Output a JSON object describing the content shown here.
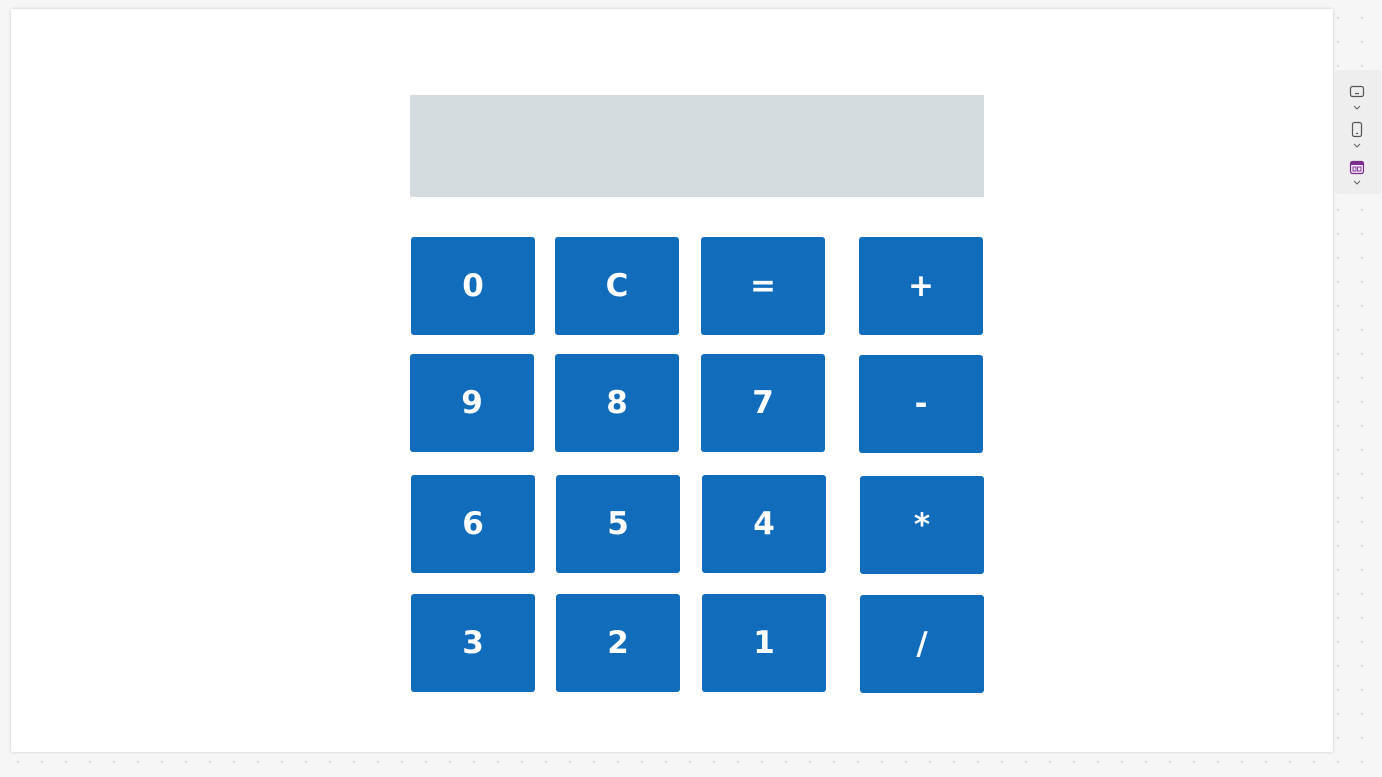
{
  "display": {
    "value": ""
  },
  "keys": {
    "k0": "0",
    "clear": "C",
    "equals": "=",
    "plus": "+",
    "k9": "9",
    "k8": "8",
    "k7": "7",
    "minus": "-",
    "k6": "6",
    "k5": "5",
    "k4": "4",
    "multiply": "*",
    "k3": "3",
    "k2": "2",
    "k1": "1",
    "divide": "/"
  },
  "side_toolbar": {
    "icons": [
      "desktop-view-icon",
      "mobile-view-icon",
      "calendar-view-icon"
    ],
    "accent_color": "#7b2d8e"
  },
  "colors": {
    "key_background": "#116dbc",
    "key_text": "#ffffff",
    "display_background": "#d5dcdf"
  }
}
